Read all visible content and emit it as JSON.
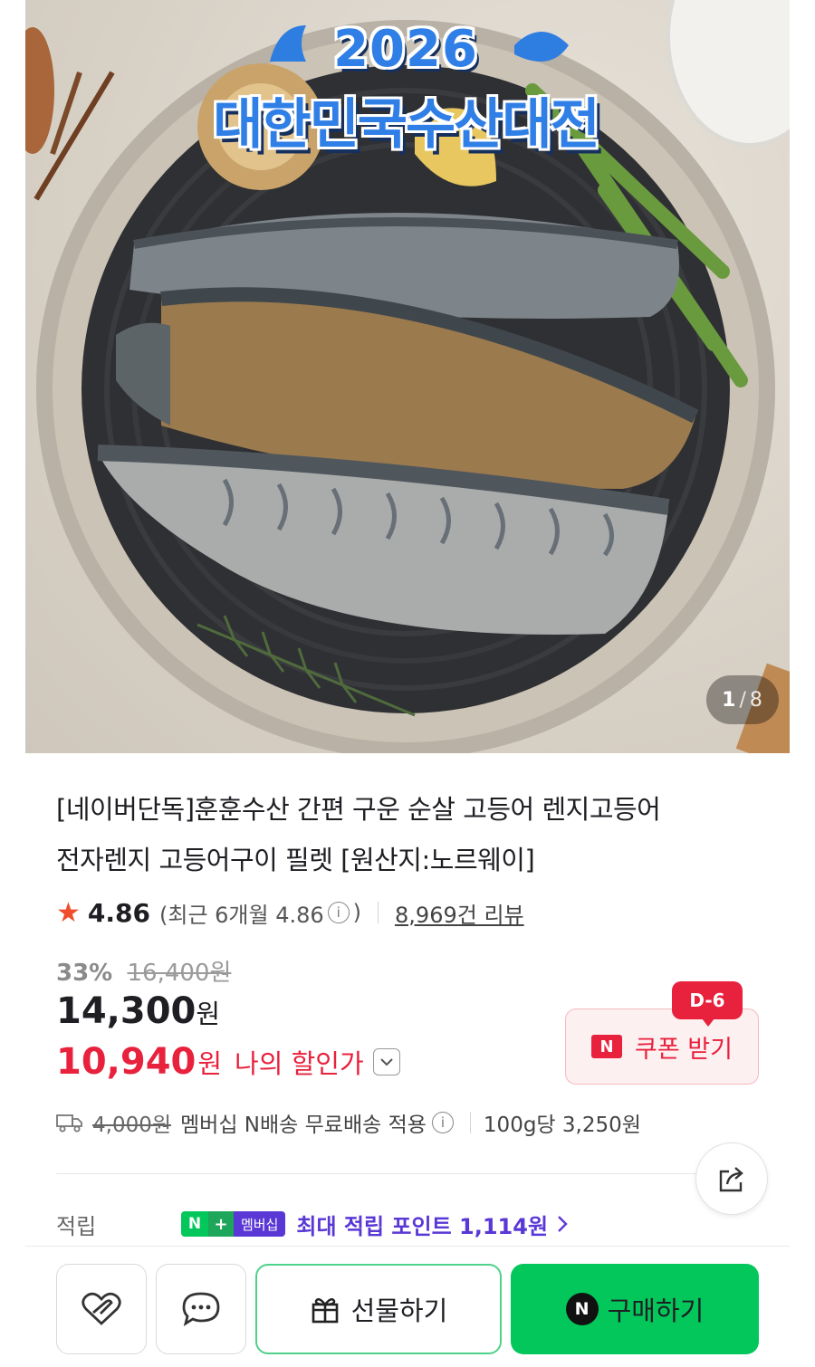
{
  "hero": {
    "year": "2026",
    "event": "대한민국수산대전",
    "counter_current": "1",
    "counter_total": "8"
  },
  "product": {
    "title_line1": "[네이버단독]훈훈수산 간편 구운 순살 고등어 렌지고등어",
    "title_line2": "전자렌지 고등어구이 필렛 [원산지:노르웨이]",
    "rating": "4.86",
    "recent_rating_label": "(최근 6개월 4.86",
    "recent_rating_close": ")",
    "review_count": "8,969건 리뷰"
  },
  "price": {
    "discount_rate": "33%",
    "original_price": "16,400원",
    "sale_price": "14,300",
    "won": "원",
    "my_price": "10,940",
    "my_price_won": "원",
    "my_price_label": "나의 할인가"
  },
  "coupon": {
    "badge": "N",
    "label": "쿠폰 받기",
    "dday": "D-6"
  },
  "shipping": {
    "original_fee": "4,000원",
    "note": "멤버십 N배송 무료배송 적용",
    "unit_price": "100g당 3,250원"
  },
  "points": {
    "label": "적립",
    "badge_n": "N",
    "badge_plus": "+",
    "badge_membership": "멤버십",
    "text": "최대 적립 포인트 1,114원"
  },
  "actions": {
    "gift_label": "선물하기",
    "buy_badge": "N",
    "buy_label": "구매하기"
  },
  "colors": {
    "accent_red": "#e8213d",
    "naver_green": "#03c75a",
    "membership_purple": "#5a38d6"
  }
}
